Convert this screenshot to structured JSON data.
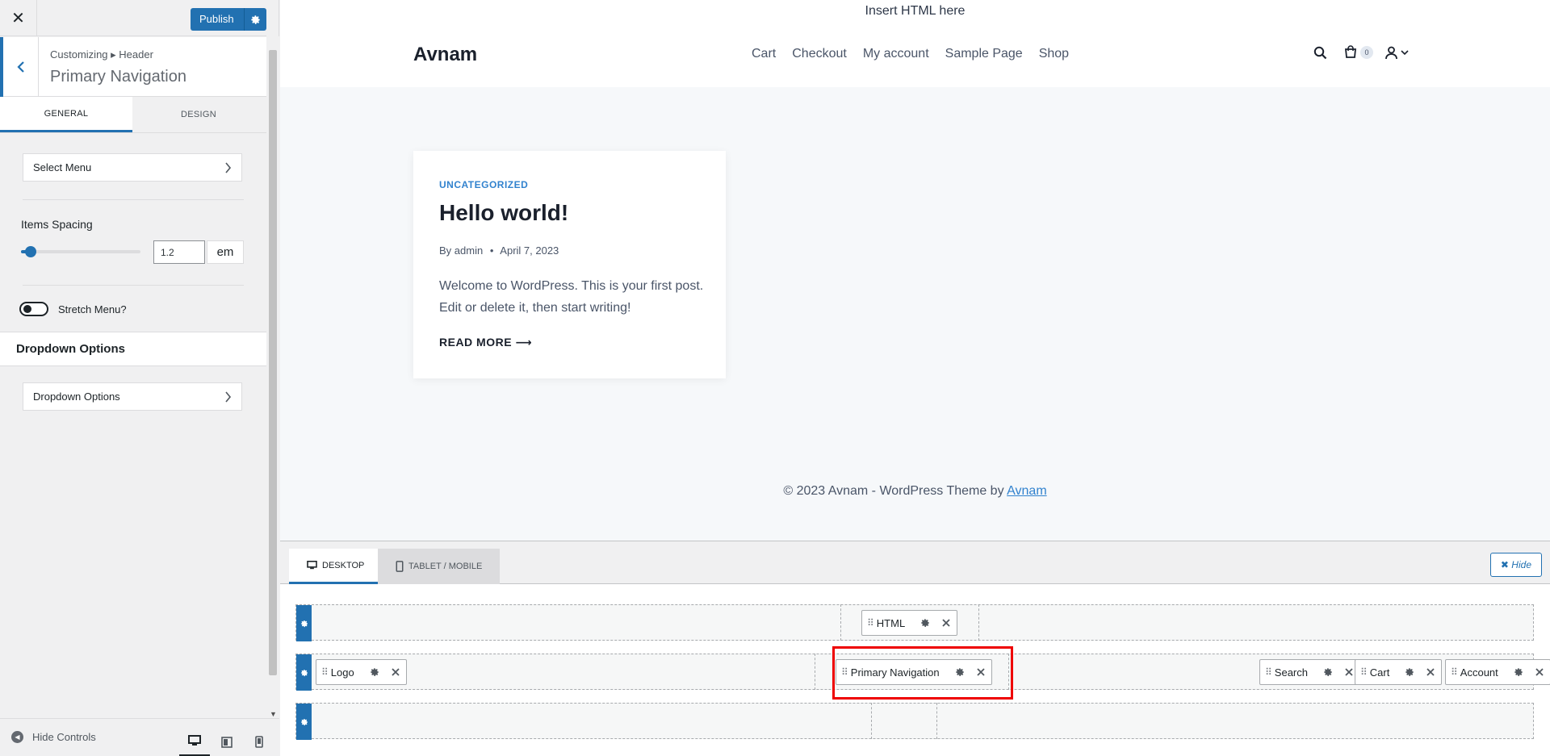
{
  "sidebar": {
    "close_symbol": "✕",
    "publish_label": "Publish",
    "breadcrumb": "Customizing ▸ Header",
    "panel_title": "Primary Navigation",
    "tabs": [
      {
        "label": "GENERAL",
        "active": true
      },
      {
        "label": "DESIGN",
        "active": false
      }
    ],
    "select_menu_label": "Select Menu",
    "items_spacing_label": "Items Spacing",
    "items_spacing_value": "1.2",
    "items_spacing_fraction": 0.08,
    "items_spacing_unit": "em",
    "stretch_menu_label": "Stretch Menu?",
    "stretch_menu_on": false,
    "dropdown_section_title": "Dropdown Options",
    "dropdown_options_label": "Dropdown Options",
    "hide_controls_label": "Hide Controls",
    "devices": [
      "desktop-icon",
      "tablet-icon",
      "mobile-icon"
    ],
    "active_device": "desktop"
  },
  "preview": {
    "html_text": "Insert HTML here",
    "logo": "Avnam",
    "nav": [
      "Cart",
      "Checkout",
      "My account",
      "Sample Page",
      "Shop"
    ],
    "cart_count": "0",
    "post": {
      "category": "UNCATEGORIZED",
      "title": "Hello world!",
      "meta_by": "By admin",
      "meta_sep": "•",
      "meta_date": "April 7, 2023",
      "excerpt": "Welcome to WordPress. This is your first post. Edit or delete it, then start writing!",
      "read_more": "READ MORE ⟶"
    },
    "footer_text": "© 2023 Avnam - WordPress Theme by ",
    "footer_link": "Avnam"
  },
  "builder": {
    "tab_desktop": "DESKTOP",
    "tab_tablet": "TABLET / MOBILE",
    "hide_label": "✖ Hide",
    "rows": {
      "top": [
        {
          "label": "HTML"
        }
      ],
      "main_left": [
        {
          "label": "Logo"
        }
      ],
      "main_center": [
        {
          "label": "Primary Navigation"
        }
      ],
      "main_right": [
        {
          "label": "Search"
        },
        {
          "label": "Cart"
        },
        {
          "label": "Account"
        }
      ]
    }
  },
  "colors": {
    "accent": "#2271b1",
    "highlight": "#ee0000"
  }
}
